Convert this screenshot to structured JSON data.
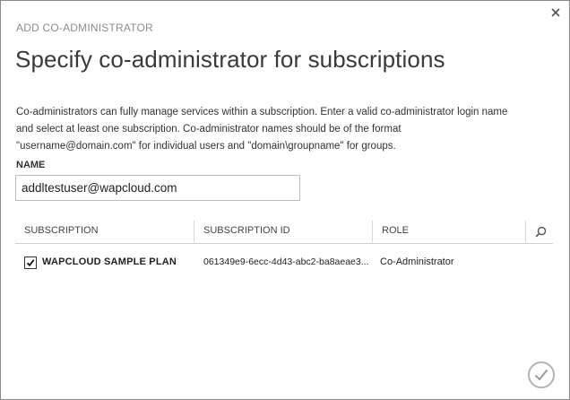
{
  "dialog": {
    "kicker": "ADD CO-ADMINISTRATOR",
    "title": "Specify co-administrator for subscriptions",
    "description_lines": [
      "Co-administrators can fully manage services within a subscription. Enter a valid co-administrator login name",
      "and select at least one subscription. Co-administrator names should be of the format",
      "\"username@domain.com\" for individual users and \"domain\\groupname\" for groups."
    ]
  },
  "form": {
    "name_label": "NAME",
    "name_value": "addltestuser@wapcloud.com"
  },
  "grid": {
    "columns": [
      "SUBSCRIPTION",
      "SUBSCRIPTION ID",
      "ROLE"
    ],
    "rows": [
      {
        "checked": true,
        "subscription": "WAPCLOUD SAMPLE PLAN",
        "subscription_id": "061349e9-6ecc-4d43-abc2-ba8aeae3...",
        "role": "Co-Administrator"
      }
    ]
  },
  "icons": {
    "close": "close-icon",
    "search": "search-icon",
    "confirm": "checkmark-icon",
    "checkbox": "checkbox-checked-icon"
  },
  "colors": {
    "border": "#8a8a8a",
    "kicker_text": "#8c8c8c",
    "title_text": "#3a3a3a",
    "ok_ring": "#b3b3b3"
  }
}
